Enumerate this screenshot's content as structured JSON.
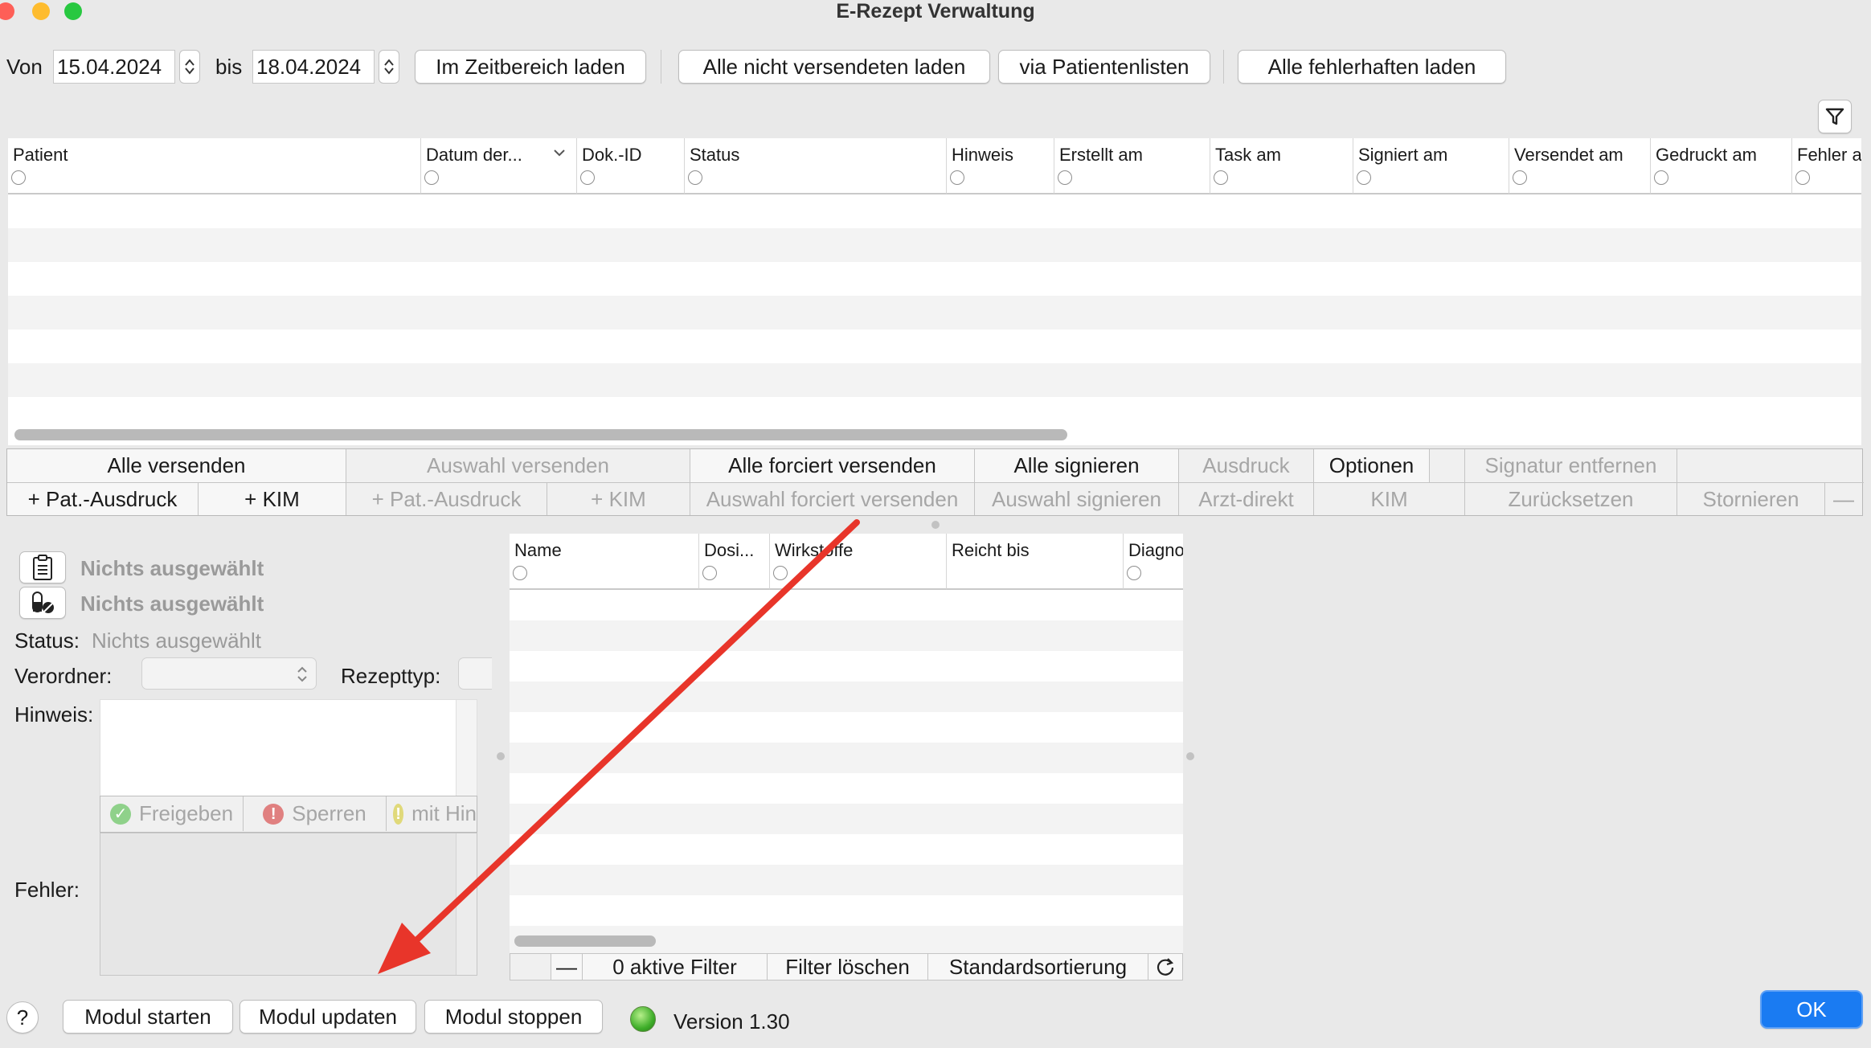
{
  "window": {
    "title": "E-Rezept Verwaltung"
  },
  "toolbar": {
    "von_label": "Von",
    "von_value": "15.04.2024",
    "bis_label": "bis",
    "bis_value": "18.04.2024",
    "btn_zeitbereich": "Im Zeitbereich laden",
    "btn_nicht_versendet": "Alle nicht versendeten laden",
    "btn_patientenlisten": "via Patientenlisten",
    "btn_fehlerhaft": "Alle fehlerhaften laden"
  },
  "main_table": {
    "columns": [
      "Patient",
      "Datum der...",
      "Dok.-ID",
      "Status",
      "Hinweis",
      "Erstellt am",
      "Task am",
      "Signiert am",
      "Versendet am",
      "Gedruckt am",
      "Fehler a"
    ]
  },
  "actions": {
    "row1": [
      "Alle versenden",
      "Auswahl versenden",
      "Alle forciert versenden",
      "Alle signieren",
      "Ausdruck",
      "Optionen",
      "",
      "Signatur entfernen",
      ""
    ],
    "row2": [
      "+ Pat.-Ausdruck",
      "+ KIM",
      "+ Pat.-Ausdruck",
      "+ KIM",
      "Auswahl forciert versenden",
      "Auswahl signieren",
      "Arzt-direkt",
      "KIM",
      "Zurücksetzen",
      "Stornieren",
      "—"
    ]
  },
  "details": {
    "nichts1": "Nichts ausgewählt",
    "nichts2": "Nichts ausgewählt",
    "status_label": "Status:",
    "status_value": "Nichts ausgewählt",
    "verordner_label": "Verordner:",
    "rezepttyp_label": "Rezepttyp:",
    "hinweis_label": "Hinweis:",
    "fehler_label": "Fehler:",
    "freigeben": "Freigeben",
    "sperren": "Sperren",
    "mit_hinweis": "mit Hin"
  },
  "med_table": {
    "columns": [
      "Name",
      "Dosi...",
      "Wirkstoffe",
      "Reicht bis",
      "Diagno"
    ],
    "footer_minus": "—",
    "footer_filter": "0 aktive Filter",
    "footer_clear": "Filter löschen",
    "footer_sort": "Standardsortierung"
  },
  "bottom": {
    "help": "?",
    "start": "Modul starten",
    "update": "Modul updaten",
    "stop": "Modul stoppen",
    "version": "Version 1.30",
    "ok": "OK"
  },
  "colors": {
    "accent": "#1a7bf2",
    "arrow": "#e8352a",
    "status_led": "#3fae2a"
  }
}
